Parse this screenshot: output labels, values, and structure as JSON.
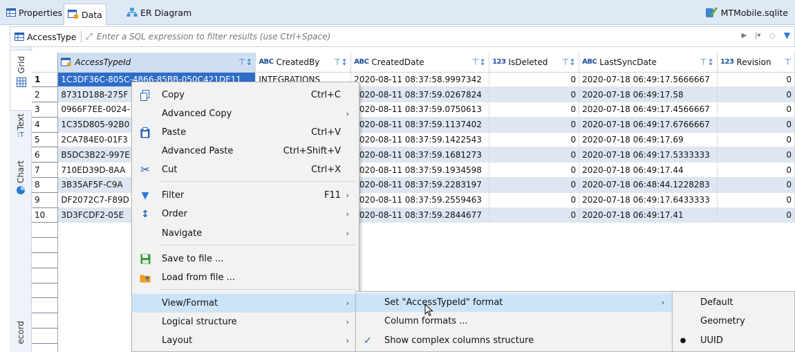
{
  "tabs": [
    {
      "label": "Properties",
      "icon": "table-icon"
    },
    {
      "label": "Data",
      "icon": "data-icon"
    },
    {
      "label": "ER Diagram",
      "icon": "er-diagram-icon"
    }
  ],
  "file_name": "MTMobile.sqlite",
  "filter": {
    "table_name": "AccessType",
    "placeholder": "Enter a SQL expression to filter results (use Ctrl+Space)"
  },
  "side_tabs": [
    "Grid",
    "Text",
    "Chart",
    "ecord"
  ],
  "grid": {
    "columns": [
      {
        "type": "",
        "name": "AccessTypeId"
      },
      {
        "type": "ABC",
        "name": "CreatedBy"
      },
      {
        "type": "ABC",
        "name": "CreatedDate"
      },
      {
        "type": "123",
        "name": "IsDeleted"
      },
      {
        "type": "ABC",
        "name": "LastSyncDate"
      },
      {
        "type": "123",
        "name": "Revision"
      }
    ],
    "rows": [
      {
        "n": "1",
        "id": "1C3DF36C-805C-4866-85BB-050C421DE11",
        "by": "INTEGRATIONS",
        "date": "2020-08-11 08:37:58.9997342",
        "del": "0",
        "sync": "2020-07-18 06:49:17.5666667",
        "rev": "0"
      },
      {
        "n": "2",
        "id": "8731D188-275F",
        "by": "",
        "date": "2020-08-11 08:37:59.0267824",
        "del": "0",
        "sync": "2020-07-18 06:49:17.58",
        "rev": "0"
      },
      {
        "n": "3",
        "id": "0966F7EE-0024-",
        "by": "",
        "date": "2020-08-11 08:37:59.0750613",
        "del": "0",
        "sync": "2020-07-18 06:49:17.4566667",
        "rev": "0"
      },
      {
        "n": "4",
        "id": "1C35D805-92B0",
        "by": "",
        "date": "2020-08-11 08:37:59.1137402",
        "del": "0",
        "sync": "2020-07-18 06:49:17.6766667",
        "rev": "0"
      },
      {
        "n": "5",
        "id": "2CA784E0-01F3",
        "by": "",
        "date": "2020-08-11 08:37:59.1422543",
        "del": "0",
        "sync": "2020-07-18 06:49:17.69",
        "rev": "0"
      },
      {
        "n": "6",
        "id": "B5DC3B22-997E",
        "by": "",
        "date": "2020-08-11 08:37:59.1681273",
        "del": "0",
        "sync": "2020-07-18 06:49:17.5333333",
        "rev": "0"
      },
      {
        "n": "7",
        "id": "710ED39D-8AA",
        "by": "",
        "date": "2020-08-11 08:37:59.1934598",
        "del": "0",
        "sync": "2020-07-18 06:49:17.44",
        "rev": "0"
      },
      {
        "n": "8",
        "id": "3B35AF5F-C9A",
        "by": "",
        "date": "2020-08-11 08:37:59.2283197",
        "del": "0",
        "sync": "2020-07-18 06:48:44.1228283",
        "rev": "0"
      },
      {
        "n": "9",
        "id": "DF2072C7-F89D",
        "by": "",
        "date": "2020-08-11 08:37:59.2559463",
        "del": "0",
        "sync": "2020-07-18 06:49:17.6433333",
        "rev": "0"
      },
      {
        "n": "10",
        "id": "3D3FCDF2-05E",
        "by": "",
        "date": "2020-08-11 08:37:59.2844677",
        "del": "0",
        "sync": "2020-07-18 06:49:17.41",
        "rev": "0"
      }
    ]
  },
  "context_menu": {
    "items": [
      {
        "label": "Copy",
        "shortcut": "Ctrl+C",
        "icon": "copy-icon"
      },
      {
        "label": "Advanced Copy",
        "shortcut": "",
        "submenu": true
      },
      {
        "label": "Paste",
        "shortcut": "Ctrl+V",
        "icon": "paste-icon"
      },
      {
        "label": "Advanced Paste",
        "shortcut": "Ctrl+Shift+V"
      },
      {
        "label": "Cut",
        "shortcut": "Ctrl+X",
        "icon": "cut-icon"
      },
      {
        "label": "Filter",
        "shortcut": "F11",
        "submenu": true,
        "icon": "filter-icon"
      },
      {
        "label": "Order",
        "submenu": true,
        "icon": "order-icon"
      },
      {
        "label": "Navigate",
        "submenu": true
      },
      {
        "label": "Save to file ...",
        "icon": "save-icon"
      },
      {
        "label": "Load from file ...",
        "icon": "load-icon"
      },
      {
        "label": "View/Format",
        "submenu": true,
        "highlighted": true
      },
      {
        "label": "Logical structure",
        "submenu": true
      },
      {
        "label": "Layout",
        "submenu": true
      }
    ]
  },
  "format_submenu": {
    "items": [
      {
        "label": "Set \"AccessTypeId\" format",
        "submenu": true,
        "highlighted": true
      },
      {
        "label": "Column formats ..."
      },
      {
        "label": "Show complex columns structure",
        "checked": true
      }
    ]
  },
  "format_options": {
    "items": [
      {
        "label": "Default"
      },
      {
        "label": "Geometry"
      },
      {
        "label": "UUID",
        "selected": true
      }
    ]
  },
  "colors": {
    "selection": "#2f6cc8",
    "highlight": "#cce4f7",
    "alt_row": "#dde6f2"
  }
}
